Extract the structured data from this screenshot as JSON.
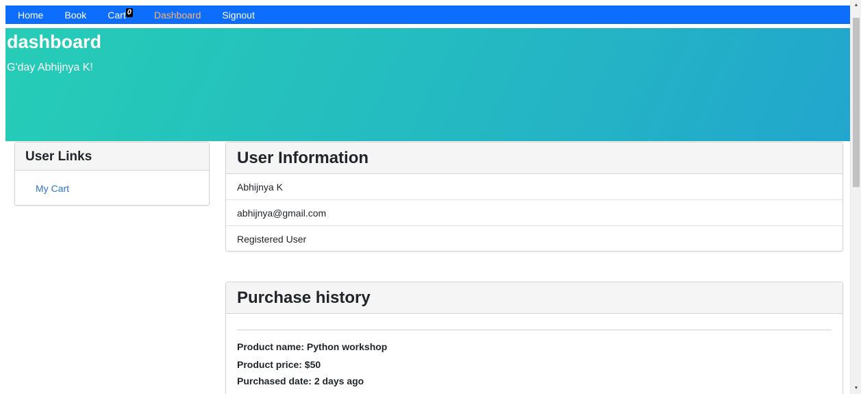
{
  "navbar": {
    "items": [
      {
        "label": "Home",
        "active": false
      },
      {
        "label": "Book",
        "active": false
      },
      {
        "label": "Cart",
        "active": false,
        "badge": "0"
      },
      {
        "label": "Dashboard",
        "active": true
      },
      {
        "label": "Signout",
        "active": false
      }
    ],
    "background_color": "#0d6efd",
    "active_color": "#ffb366"
  },
  "hero": {
    "title": "dashboard",
    "subtitle": "G'day Abhijnya K!"
  },
  "user_links": {
    "title": "User Links",
    "links": [
      {
        "label": "My Cart"
      }
    ]
  },
  "user_info": {
    "title": "User Information",
    "rows": [
      "Abhijnya K",
      "abhijnya@gmail.com",
      "Registered User"
    ]
  },
  "purchase_history": {
    "title": "Purchase history",
    "items": [
      {
        "name_line": "Product name: Python workshop",
        "price_line": "Product price: $50",
        "date_line": "Purchased date: 2 days ago"
      }
    ]
  },
  "scrollbar": {
    "up_icon": "triangle-up-icon",
    "down_icon": "triangle-down-icon"
  }
}
